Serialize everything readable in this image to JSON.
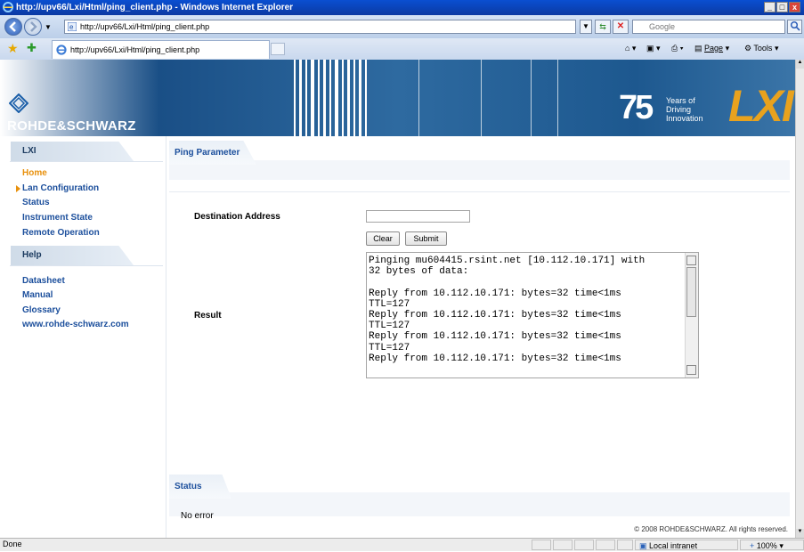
{
  "browser": {
    "window_title": "http://upv66/Lxi/Html/ping_client.php - Windows Internet Explorer",
    "address": "http://upv66/Lxi/Html/ping_client.php",
    "search_placeholder": "Google",
    "tab_title": "http://upv66/Lxi/Html/ping_client.php",
    "commands": {
      "page": "Page",
      "tools": "Tools"
    },
    "status": {
      "text": "Done",
      "zone": "Local intranet",
      "zoom": "100%"
    }
  },
  "banner": {
    "brand": "ROHDE&SCHWARZ",
    "anniversary_number": "75",
    "anniversary_lines": [
      "Years of",
      "Driving",
      "Innovation"
    ],
    "product_logo": "LXI"
  },
  "sidebar": {
    "lxi": {
      "heading": "LXI",
      "items": [
        {
          "label": "Home",
          "active": true
        },
        {
          "label": "Lan Configuration",
          "expandable": true
        },
        {
          "label": "Status"
        },
        {
          "label": "Instrument State"
        },
        {
          "label": "Remote Operation"
        }
      ]
    },
    "help": {
      "heading": "Help",
      "items": [
        {
          "label": "Datasheet"
        },
        {
          "label": "Manual"
        },
        {
          "label": "Glossary"
        },
        {
          "label": "www.rohde-schwarz.com"
        }
      ]
    }
  },
  "ping": {
    "section_title": "Ping Parameter",
    "destination_label": "Destination Address",
    "destination_value": "",
    "clear_label": "Clear",
    "submit_label": "Submit",
    "result_label": "Result",
    "result_lines": [
      "Pinging mu604415.rsint.net [10.112.10.171] with",
      "32 bytes of data:",
      "",
      "Reply from 10.112.10.171: bytes=32 time<1ms",
      "TTL=127",
      "Reply from 10.112.10.171: bytes=32 time<1ms",
      "TTL=127",
      "Reply from 10.112.10.171: bytes=32 time<1ms",
      "TTL=127",
      "Reply from 10.112.10.171: bytes=32 time<1ms"
    ]
  },
  "status_section": {
    "title": "Status",
    "message": "No error"
  },
  "footer": {
    "copyright": "© 2008 ROHDE&SCHWARZ. All rights reserved."
  },
  "colors": {
    "link": "#1c4f9c",
    "active_link": "#e8900c",
    "banner_blue": "#1a4f86",
    "lxi_orange": "#e8a21e"
  }
}
